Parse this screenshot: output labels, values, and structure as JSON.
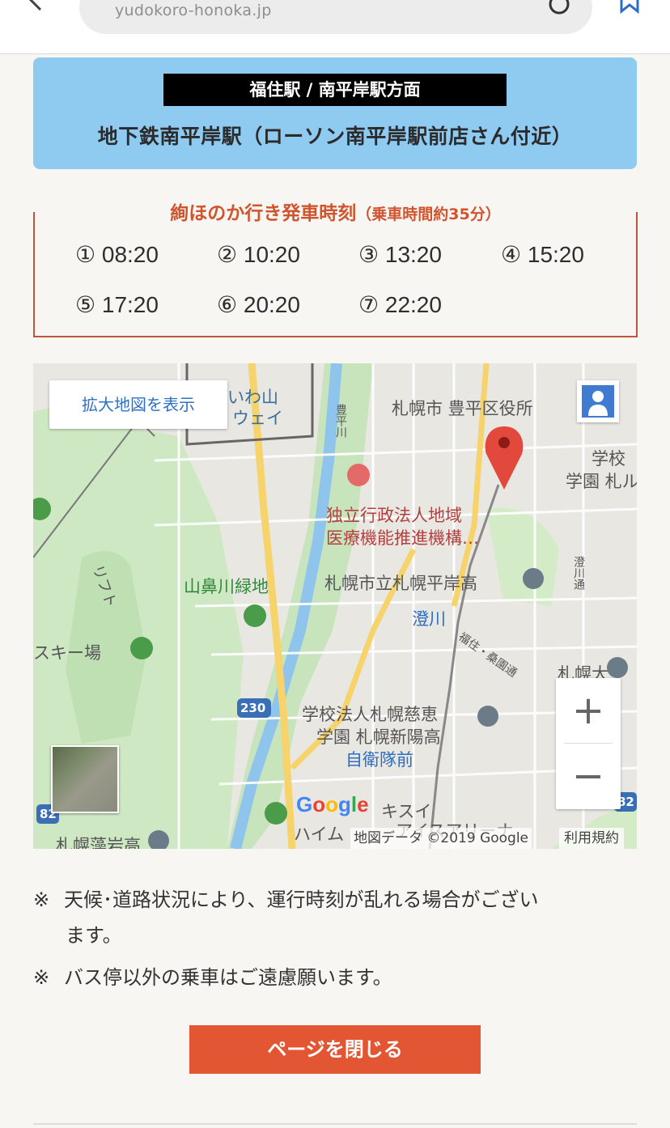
{
  "browser": {
    "url": "yudokoro-honoka.jp",
    "back_icon": "chevron-left-icon",
    "reload_icon": "reload-icon",
    "bookmark_icon": "bookmark-icon"
  },
  "station": {
    "direction_label": "福住駅 / 南平岸駅方面",
    "name": "地下鉄南平岸駅（ローソン南平岸駅前店さん付近）"
  },
  "timetable": {
    "title": "絢ほのか行き発車時刻",
    "subtitle": "（乗車時間約35分）",
    "times": [
      "① 08:20",
      "② 10:20",
      "③ 13:20",
      "④ 15:20",
      "⑤ 17:20",
      "⑥ 20:20",
      "⑦ 22:20"
    ]
  },
  "map": {
    "enlarge_label": "拡大地図を表示",
    "labels": {
      "ward_office": "札幌市 豊平区役所",
      "hospital_1": "独立行政法人地域",
      "hospital_2": "医療機能推進機構…",
      "high_school": "札幌市立札幌平岸高",
      "sumikawa": "澄川",
      "greenbelt": "山鼻川緑地",
      "ski": "スキー場",
      "lift": "リフト",
      "school_1": "学校法人札幌慈恵",
      "school_2": "学園 札幌新陽高",
      "jieitai": "自衛隊前",
      "sappo_dai": "札幌大",
      "school_r1": "学校",
      "school_r2": "学園 札ル",
      "route_230": "230",
      "route_82": "82",
      "fukuzumi_line": "福住・桑園通",
      "river": "豊平川",
      "iwayama_1": "いわ山",
      "iwayama_2": "ウェイ",
      "sumikawa_dori": "澄川通",
      "kisui_1": "キスイ",
      "kisui_2": "アイスアリーナ",
      "heim": "ハイム",
      "fujino": "札幌藻岩高"
    },
    "google_logo": "Google",
    "attribution": "地図データ ©2019 Google",
    "terms": "利用規約",
    "zoom_in": "+",
    "zoom_out": "−"
  },
  "notes": [
    {
      "mark": "※",
      "line1": "天候･道路状況により、運行時刻が乱れる場合がござい",
      "line2": "ます。"
    },
    {
      "mark": "※",
      "line1": "バス停以外の乗車はご遠慮願います。"
    }
  ],
  "close_button": "ページを閉じる"
}
